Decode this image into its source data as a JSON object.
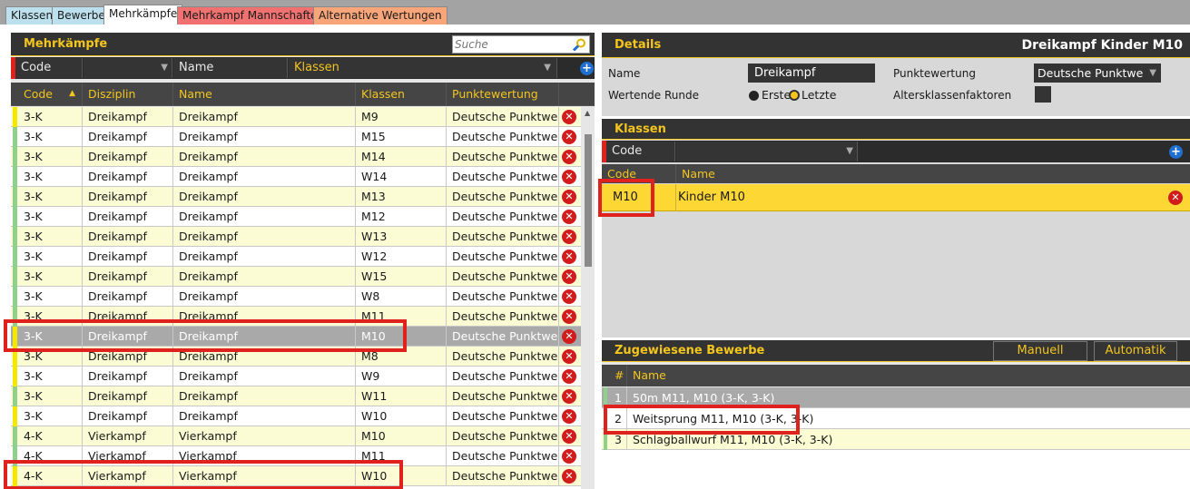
{
  "tabs": [
    {
      "label": "Klassen",
      "bg": "#bde0ee"
    },
    {
      "label": "Bewerbe",
      "bg": "#bde0ee"
    },
    {
      "label": "Mehrkämpfe",
      "bg": "#ffffff"
    },
    {
      "label": "Mehrkampf Mannschaften",
      "bg": "#f0716f"
    },
    {
      "label": "Alternative Wertungen",
      "bg": "#f8a579"
    }
  ],
  "left": {
    "title": "Mehrkämpfe",
    "search_placeholder": "Suche",
    "filter": {
      "code_label": "Code",
      "name_label": "Name",
      "klassen_label": "Klassen"
    },
    "columns": [
      "Code",
      "Disziplin",
      "Name",
      "Klassen",
      "Punktewertung"
    ],
    "rows": [
      {
        "code": "3-K",
        "disziplin": "Dreikampf",
        "name": "Dreikampf",
        "klassen": "M9",
        "punkte": "Deutsche Punktwertung",
        "stripe": "#f5e800",
        "bg": "#fbfbd4"
      },
      {
        "code": "3-K",
        "disziplin": "Dreikampf",
        "name": "Dreikampf",
        "klassen": "M15",
        "punkte": "Deutsche Punktwertung",
        "stripe": "#8fd18a",
        "bg": "#ffffff"
      },
      {
        "code": "3-K",
        "disziplin": "Dreikampf",
        "name": "Dreikampf",
        "klassen": "M14",
        "punkte": "Deutsche Punktwertung",
        "stripe": "#8fd18a",
        "bg": "#fbfbd4"
      },
      {
        "code": "3-K",
        "disziplin": "Dreikampf",
        "name": "Dreikampf",
        "klassen": "W14",
        "punkte": "Deutsche Punktwertung",
        "stripe": "#8fd18a",
        "bg": "#ffffff"
      },
      {
        "code": "3-K",
        "disziplin": "Dreikampf",
        "name": "Dreikampf",
        "klassen": "M13",
        "punkte": "Deutsche Punktwertung",
        "stripe": "#8fd18a",
        "bg": "#fbfbd4"
      },
      {
        "code": "3-K",
        "disziplin": "Dreikampf",
        "name": "Dreikampf",
        "klassen": "M12",
        "punkte": "Deutsche Punktwertung",
        "stripe": "#8fd18a",
        "bg": "#ffffff"
      },
      {
        "code": "3-K",
        "disziplin": "Dreikampf",
        "name": "Dreikampf",
        "klassen": "W13",
        "punkte": "Deutsche Punktwertung",
        "stripe": "#8fd18a",
        "bg": "#fbfbd4"
      },
      {
        "code": "3-K",
        "disziplin": "Dreikampf",
        "name": "Dreikampf",
        "klassen": "W12",
        "punkte": "Deutsche Punktwertung",
        "stripe": "#8fd18a",
        "bg": "#ffffff"
      },
      {
        "code": "3-K",
        "disziplin": "Dreikampf",
        "name": "Dreikampf",
        "klassen": "W15",
        "punkte": "Deutsche Punktwertung",
        "stripe": "#8fd18a",
        "bg": "#fbfbd4"
      },
      {
        "code": "3-K",
        "disziplin": "Dreikampf",
        "name": "Dreikampf",
        "klassen": "W8",
        "punkte": "Deutsche Punktwertung",
        "stripe": "#8fd18a",
        "bg": "#ffffff"
      },
      {
        "code": "3-K",
        "disziplin": "Dreikampf",
        "name": "Dreikampf",
        "klassen": "M11",
        "punkte": "Deutsche Punktwertung",
        "stripe": "#8fd18a",
        "bg": "#fbfbd4"
      },
      {
        "code": "3-K",
        "disziplin": "Dreikampf",
        "name": "Dreikampf",
        "klassen": "M10",
        "punkte": "Deutsche Punktwertung",
        "stripe": "#f5e800",
        "bg": "#a9a9a9",
        "selected": true
      },
      {
        "code": "3-K",
        "disziplin": "Dreikampf",
        "name": "Dreikampf",
        "klassen": "M8",
        "punkte": "Deutsche Punktwertung",
        "stripe": "#f5e800",
        "bg": "#fbfbd4"
      },
      {
        "code": "3-K",
        "disziplin": "Dreikampf",
        "name": "Dreikampf",
        "klassen": "W9",
        "punkte": "Deutsche Punktwertung",
        "stripe": "#f5e800",
        "bg": "#ffffff"
      },
      {
        "code": "3-K",
        "disziplin": "Dreikampf",
        "name": "Dreikampf",
        "klassen": "W11",
        "punkte": "Deutsche Punktwertung",
        "stripe": "#8fd18a",
        "bg": "#fbfbd4"
      },
      {
        "code": "3-K",
        "disziplin": "Dreikampf",
        "name": "Dreikampf",
        "klassen": "W10",
        "punkte": "Deutsche Punktwertung",
        "stripe": "#f5e800",
        "bg": "#ffffff"
      },
      {
        "code": "4-K",
        "disziplin": "Vierkampf",
        "name": "Vierkampf",
        "klassen": "M10",
        "punkte": "Deutsche Punktwertung",
        "stripe": "#8fd18a",
        "bg": "#fbfbd4"
      },
      {
        "code": "4-K",
        "disziplin": "Vierkampf",
        "name": "Vierkampf",
        "klassen": "M11",
        "punkte": "Deutsche Punktwertung",
        "stripe": "#8fd18a",
        "bg": "#ffffff"
      },
      {
        "code": "4-K",
        "disziplin": "Vierkampf",
        "name": "Vierkampf",
        "klassen": "W10",
        "punkte": "Deutsche Punktwertung",
        "stripe": "#f5e800",
        "bg": "#fbfbd4"
      }
    ]
  },
  "details": {
    "title": "Details",
    "subject": "Dreikampf Kinder M10",
    "name_label": "Name",
    "name_value": "Dreikampf",
    "wertende_label": "Wertende Runde",
    "radio_erste": "Erste",
    "radio_letzte": "Letzte",
    "punkte_label": "Punktewertung",
    "punkte_value": "Deutsche Punktwertung",
    "alters_label": "Altersklassenfaktoren"
  },
  "klassen": {
    "title": "Klassen",
    "filter_code": "Code",
    "col_code": "Code",
    "col_name": "Name",
    "rows": [
      {
        "code": "M10",
        "name": "Kinder M10"
      }
    ]
  },
  "bewerbe": {
    "title": "Zugewiesene Bewerbe",
    "btn_manuell": "Manuell",
    "btn_automatik": "Automatik",
    "col_num": "#",
    "col_name": "Name",
    "rows": [
      {
        "num": "1",
        "name": "50m M11, M10 (3-K, 3-K)",
        "bg": "#a9a9a9"
      },
      {
        "num": "2",
        "name": "Weitsprung M11, M10 (3-K, 3-K)",
        "bg": "#ffffff"
      },
      {
        "num": "3",
        "name": "Schlagballwurf M11, M10 (3-K, 3-K)",
        "bg": "#fbfbd4"
      }
    ]
  }
}
